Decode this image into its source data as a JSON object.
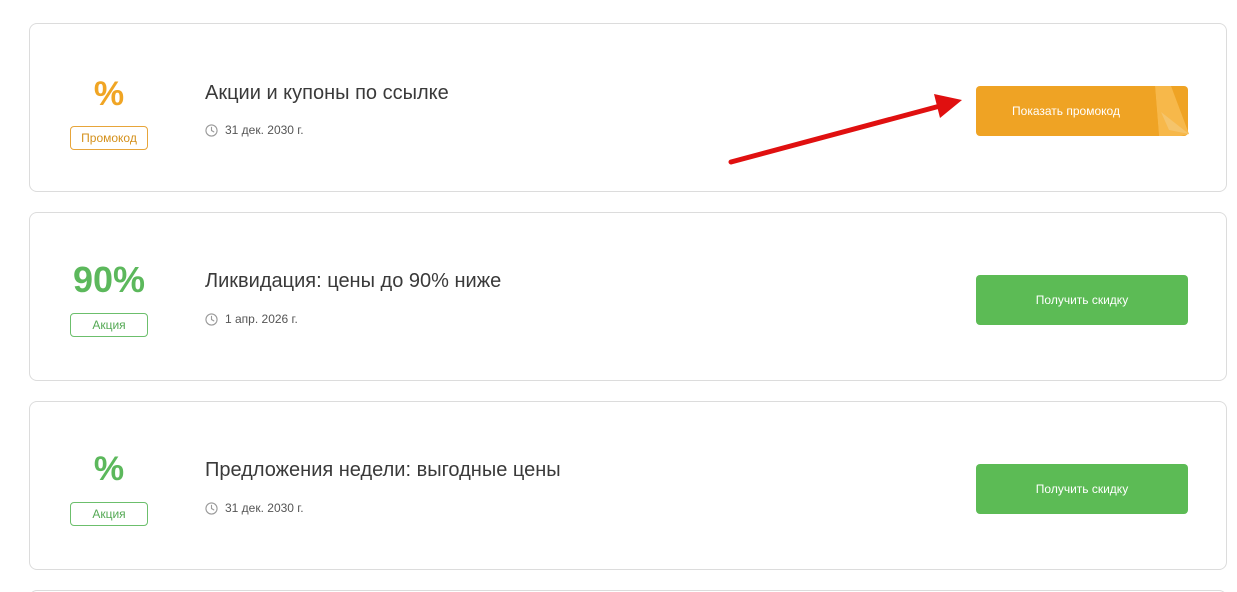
{
  "offers": [
    {
      "value": "%",
      "tag": "Промокод",
      "title": "Акции и купоны по ссылке",
      "date": "31 дек. 2030 г.",
      "button": "Показать промокод"
    },
    {
      "value": "90%",
      "tag": "Акция",
      "title": "Ликвидация: цены до 90% ниже",
      "date": "1 апр. 2026 г.",
      "button": "Получить скидку"
    },
    {
      "value": "%",
      "tag": "Акция",
      "title": "Предложения недели: выгодные цены",
      "date": "31 дек. 2030 г.",
      "button": "Получить скидку"
    }
  ],
  "icons": {
    "date": "clock-icon",
    "annotation": "red-arrow-icon"
  },
  "colors": {
    "promo": "#f0a524",
    "deal": "#5cb85c",
    "arrow": "#e01010"
  }
}
